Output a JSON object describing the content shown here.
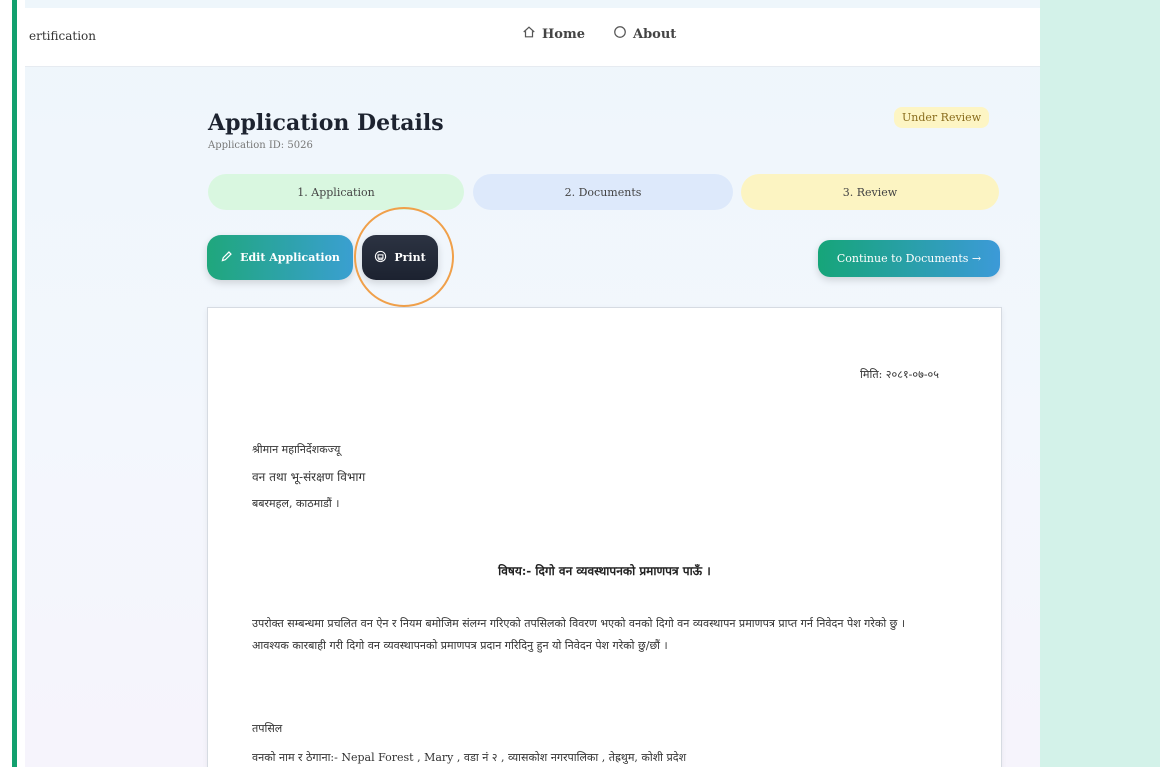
{
  "navbar": {
    "brand": "ertification",
    "links": [
      {
        "label": "Home",
        "icon": "home-icon"
      },
      {
        "label": "About",
        "icon": "info-icon"
      }
    ]
  },
  "header": {
    "title": "Application Details",
    "application_id": "Application ID: 5026",
    "status": "Under Review"
  },
  "steps": [
    {
      "label": "1. Application",
      "color": "#d9f7e0"
    },
    {
      "label": "2. Documents",
      "color": "#dde9fb"
    },
    {
      "label": "3. Review",
      "color": "#fcf4c2"
    }
  ],
  "actions": {
    "edit_label": "Edit Application",
    "print_label": "Print",
    "continue_label": "Continue to Documents →"
  },
  "document": {
    "date": "मिति: २०८१-०७-०५",
    "address_line1": "श्रीमान महानिर्देशकज्यू",
    "address_line2": "वन तथा भू-संरक्षण विभाग",
    "address_line3": "बबरमहल, काठमाडौं ।",
    "subject": "विषय:- दिगो वन व्यवस्थापनको प्रमाणपत्र पाऊँ ।",
    "body": "उपरोक्त सम्बन्धमा प्रचलित वन ऐन र नियम बमोजिम संलग्न गरिएको तपसिलको विवरण भएको वनको दिगो वन व्यवस्थापन प्रमाणपत्र प्राप्त गर्न निवेदन पेश गरेको छु । आवश्यक कारबाही गरी दिगो वन व्यवस्थापनको प्रमाणपत्र प्रदान गरिदिनु हुन यो निवेदन पेश गरेको छु/छौं ।",
    "tapsil": "तपसिल",
    "forest_line": "वनको नाम र ठेगाना:- Nepal Forest , Mary , वडा नं २ , व्यासकोश नगरपालिका , तेह्रथुम, कोशी प्रदेश"
  },
  "colors": {
    "accent_green": "#12a06e",
    "print_button": "#1c2230",
    "highlight_ring": "#f0a04a",
    "right_panel": "#d3f2e9"
  }
}
